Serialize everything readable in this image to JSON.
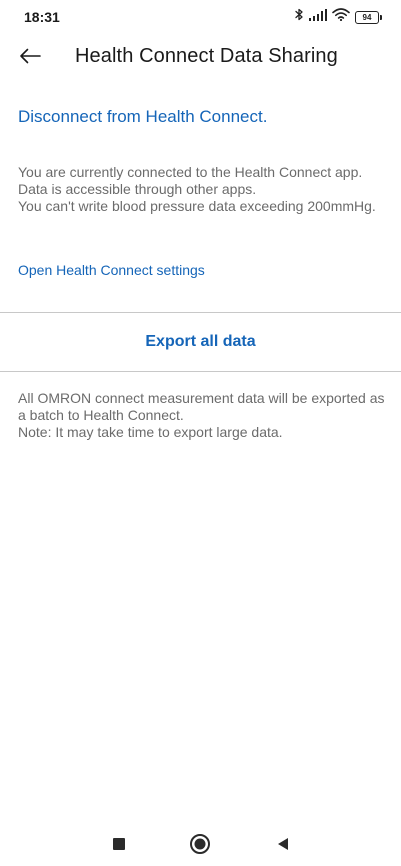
{
  "status_bar": {
    "time": "18:31",
    "battery": "94",
    "icons": [
      "bluetooth-icon",
      "signal-icon",
      "wifi-icon",
      "battery-icon"
    ]
  },
  "header": {
    "title": "Health Connect Data Sharing",
    "back_icon": "arrow-left-icon"
  },
  "content": {
    "disconnect_link": "Disconnect from Health Connect.",
    "status_lines": [
      "You are currently connected to the Health Connect app.",
      "Data is accessible through other apps.",
      "You can't write blood pressure data exceeding 200mmHg."
    ],
    "settings_link": "Open Health Connect settings",
    "export_button": "Export all data",
    "export_lines": [
      "All OMRON connect measurement data will be exported as a batch to Health Connect.",
      "Note: It may take time to export large data."
    ]
  },
  "nav_bar": {
    "icons": [
      "recent-apps-icon",
      "home-icon",
      "back-triangle-icon"
    ]
  },
  "colors": {
    "link": "#1565b8",
    "secondary_text": "#6b6b6b",
    "divider": "#c8c8c8"
  }
}
